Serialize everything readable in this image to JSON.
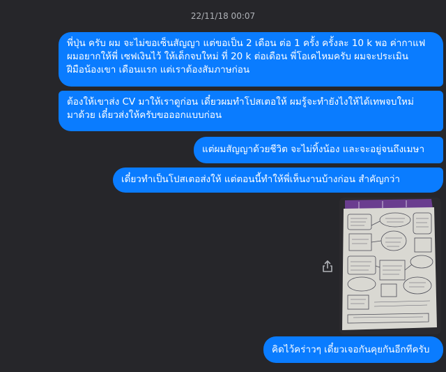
{
  "timestamp": "22/11/18 00:07",
  "messages": [
    {
      "text": "พี่ปุ่น ครับ ผม จะไม่ขอเซ็นสัญญา แต่ขอเป็น 2 เดือน ต่อ 1 ครั้ง ครั้งละ 10 k พอ ค่ากาแฟ\nผมอยากให้พี่ เซฟเงินไว้ ให้เด็กจบใหม่ ที่ 20 k ต่อเดือน พี่โอเคไหมครับ ผมจะประเมิน\nฝีมือน้องเขา เดือนแรก แต่เราต้องสัมภาษก่อน"
    },
    {
      "text": "ต้องให้เขาส่ง CV มาให้เราดูก่อน เดี๋ยวผมทำโปสเตอให้ ผมรู้จะทำยังไงให้ได้เทพจบใหม่\nมาด้วย เดี๋ยวส่งให้ครับขอออกแบบก่อน"
    },
    {
      "text": "แต่ผมสัญญาด้วยชีวิต จะไม่ทิ้งน้อง และจะอยู่จนถึงเมษา"
    },
    {
      "text": "เดี๋ยวทำเป็นโปสเตอส่งให้ แต่ตอนนี้ทำให้พี่เห็นงานบ้างก่อน สำคัญกว่า"
    },
    {
      "text": "คิดไว้คร่าวๆ เดี๋ยวเจอกันคุยกันอีกทีครับ"
    }
  ],
  "icons": {
    "share": "share-icon"
  },
  "colors": {
    "background": "#26262a",
    "bubble": "#0a7cff",
    "timestamp": "#b0b3b8"
  }
}
